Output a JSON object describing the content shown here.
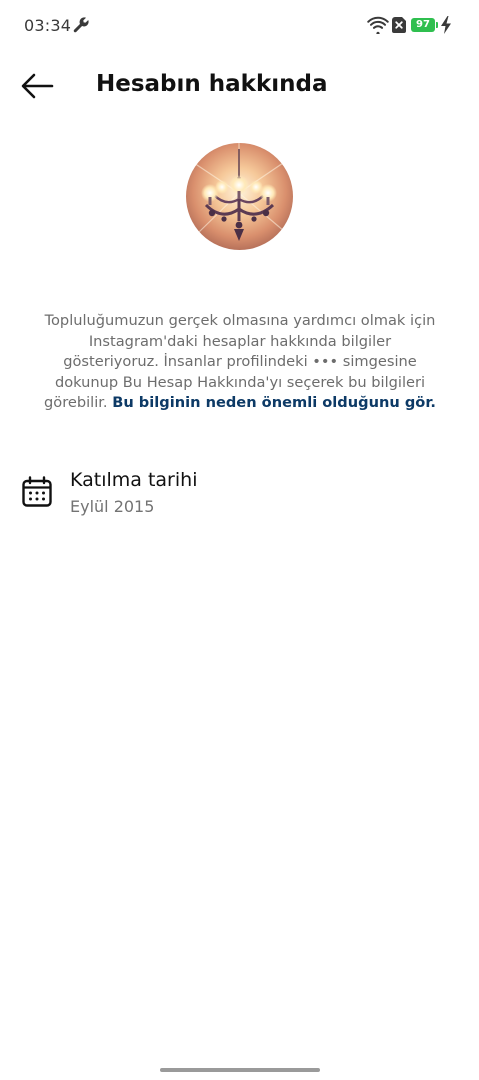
{
  "status_bar": {
    "time": "03:34",
    "battery_level": "97",
    "icons": [
      "wrench-icon",
      "wifi-icon",
      "sim-x-icon",
      "battery-icon",
      "bolt-icon"
    ],
    "battery_color": "#2fbf4f"
  },
  "header": {
    "title": "Hesabın hakkında",
    "back_icon": "arrow-left-icon"
  },
  "profile": {
    "avatar_icon": "chandelier-photo"
  },
  "description": {
    "text": "Topluluğumuzun gerçek olmasına yardımcı olmak için Instagram'daki hesaplar hakkında bilgiler gösteriyoruz. İnsanlar profilindeki ••• simgesine dokunup Bu Hesap Hakkında'yı seçerek bu bilgileri görebilir.",
    "link_text": "Bu bilginin neden önemli olduğunu gör.",
    "link_color": "#0d3a66"
  },
  "join_info": {
    "icon": "calendar-icon",
    "label": "Katılma tarihi",
    "value": "Eylül 2015"
  }
}
